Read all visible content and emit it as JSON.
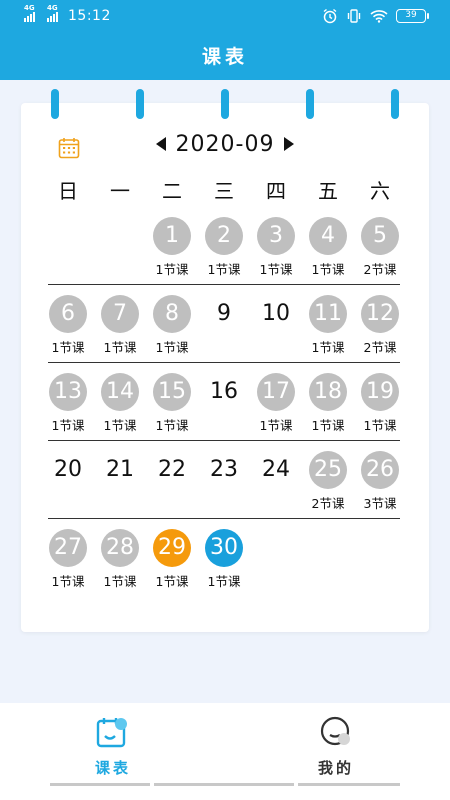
{
  "status_bar": {
    "signal1_tag": "4G",
    "signal2_tag": "4G",
    "time": "15:12",
    "battery": "39"
  },
  "header": {
    "title": "课表"
  },
  "calendar": {
    "month_label": "2020-09",
    "weekdays": [
      "日",
      "一",
      "二",
      "三",
      "四",
      "五",
      "六"
    ],
    "days": [
      {
        "day": "1",
        "lessons": "1节课",
        "style": "gray",
        "row": 0,
        "col": 2
      },
      {
        "day": "2",
        "lessons": "1节课",
        "style": "gray",
        "row": 0,
        "col": 3
      },
      {
        "day": "3",
        "lessons": "1节课",
        "style": "gray",
        "row": 0,
        "col": 4
      },
      {
        "day": "4",
        "lessons": "1节课",
        "style": "gray",
        "row": 0,
        "col": 5
      },
      {
        "day": "5",
        "lessons": "2节课",
        "style": "gray",
        "row": 0,
        "col": 6
      },
      {
        "day": "6",
        "lessons": "1节课",
        "style": "gray",
        "row": 1,
        "col": 0
      },
      {
        "day": "7",
        "lessons": "1节课",
        "style": "gray",
        "row": 1,
        "col": 1
      },
      {
        "day": "8",
        "lessons": "1节课",
        "style": "gray",
        "row": 1,
        "col": 2
      },
      {
        "day": "9",
        "lessons": "",
        "style": "plain",
        "row": 1,
        "col": 3
      },
      {
        "day": "10",
        "lessons": "",
        "style": "plain",
        "row": 1,
        "col": 4
      },
      {
        "day": "11",
        "lessons": "1节课",
        "style": "gray",
        "row": 1,
        "col": 5
      },
      {
        "day": "12",
        "lessons": "2节课",
        "style": "gray",
        "row": 1,
        "col": 6
      },
      {
        "day": "13",
        "lessons": "1节课",
        "style": "gray",
        "row": 2,
        "col": 0
      },
      {
        "day": "14",
        "lessons": "1节课",
        "style": "gray",
        "row": 2,
        "col": 1
      },
      {
        "day": "15",
        "lessons": "1节课",
        "style": "gray",
        "row": 2,
        "col": 2
      },
      {
        "day": "16",
        "lessons": "",
        "style": "plain",
        "row": 2,
        "col": 3
      },
      {
        "day": "17",
        "lessons": "1节课",
        "style": "gray",
        "row": 2,
        "col": 4
      },
      {
        "day": "18",
        "lessons": "1节课",
        "style": "gray",
        "row": 2,
        "col": 5
      },
      {
        "day": "19",
        "lessons": "1节课",
        "style": "gray",
        "row": 2,
        "col": 6
      },
      {
        "day": "20",
        "lessons": "",
        "style": "plain",
        "row": 3,
        "col": 0
      },
      {
        "day": "21",
        "lessons": "",
        "style": "plain",
        "row": 3,
        "col": 1
      },
      {
        "day": "22",
        "lessons": "",
        "style": "plain",
        "row": 3,
        "col": 2
      },
      {
        "day": "23",
        "lessons": "",
        "style": "plain",
        "row": 3,
        "col": 3
      },
      {
        "day": "24",
        "lessons": "",
        "style": "plain",
        "row": 3,
        "col": 4
      },
      {
        "day": "25",
        "lessons": "2节课",
        "style": "gray",
        "row": 3,
        "col": 5
      },
      {
        "day": "26",
        "lessons": "3节课",
        "style": "gray",
        "row": 3,
        "col": 6
      },
      {
        "day": "27",
        "lessons": "1节课",
        "style": "gray",
        "row": 4,
        "col": 0
      },
      {
        "day": "28",
        "lessons": "1节课",
        "style": "gray",
        "row": 4,
        "col": 1
      },
      {
        "day": "29",
        "lessons": "1节课",
        "style": "orange",
        "row": 4,
        "col": 2
      },
      {
        "day": "30",
        "lessons": "1节课",
        "style": "blue",
        "row": 4,
        "col": 3
      }
    ]
  },
  "colors": {
    "accent": "#1ea8e0",
    "today": "#f59a0c",
    "selected": "#19a0dc",
    "past": "#bfbfbf"
  },
  "bottom_nav": {
    "tabs": [
      {
        "label": "课表",
        "icon": "schedule-icon",
        "active": true
      },
      {
        "label": "我的",
        "icon": "profile-icon",
        "active": false
      }
    ]
  }
}
